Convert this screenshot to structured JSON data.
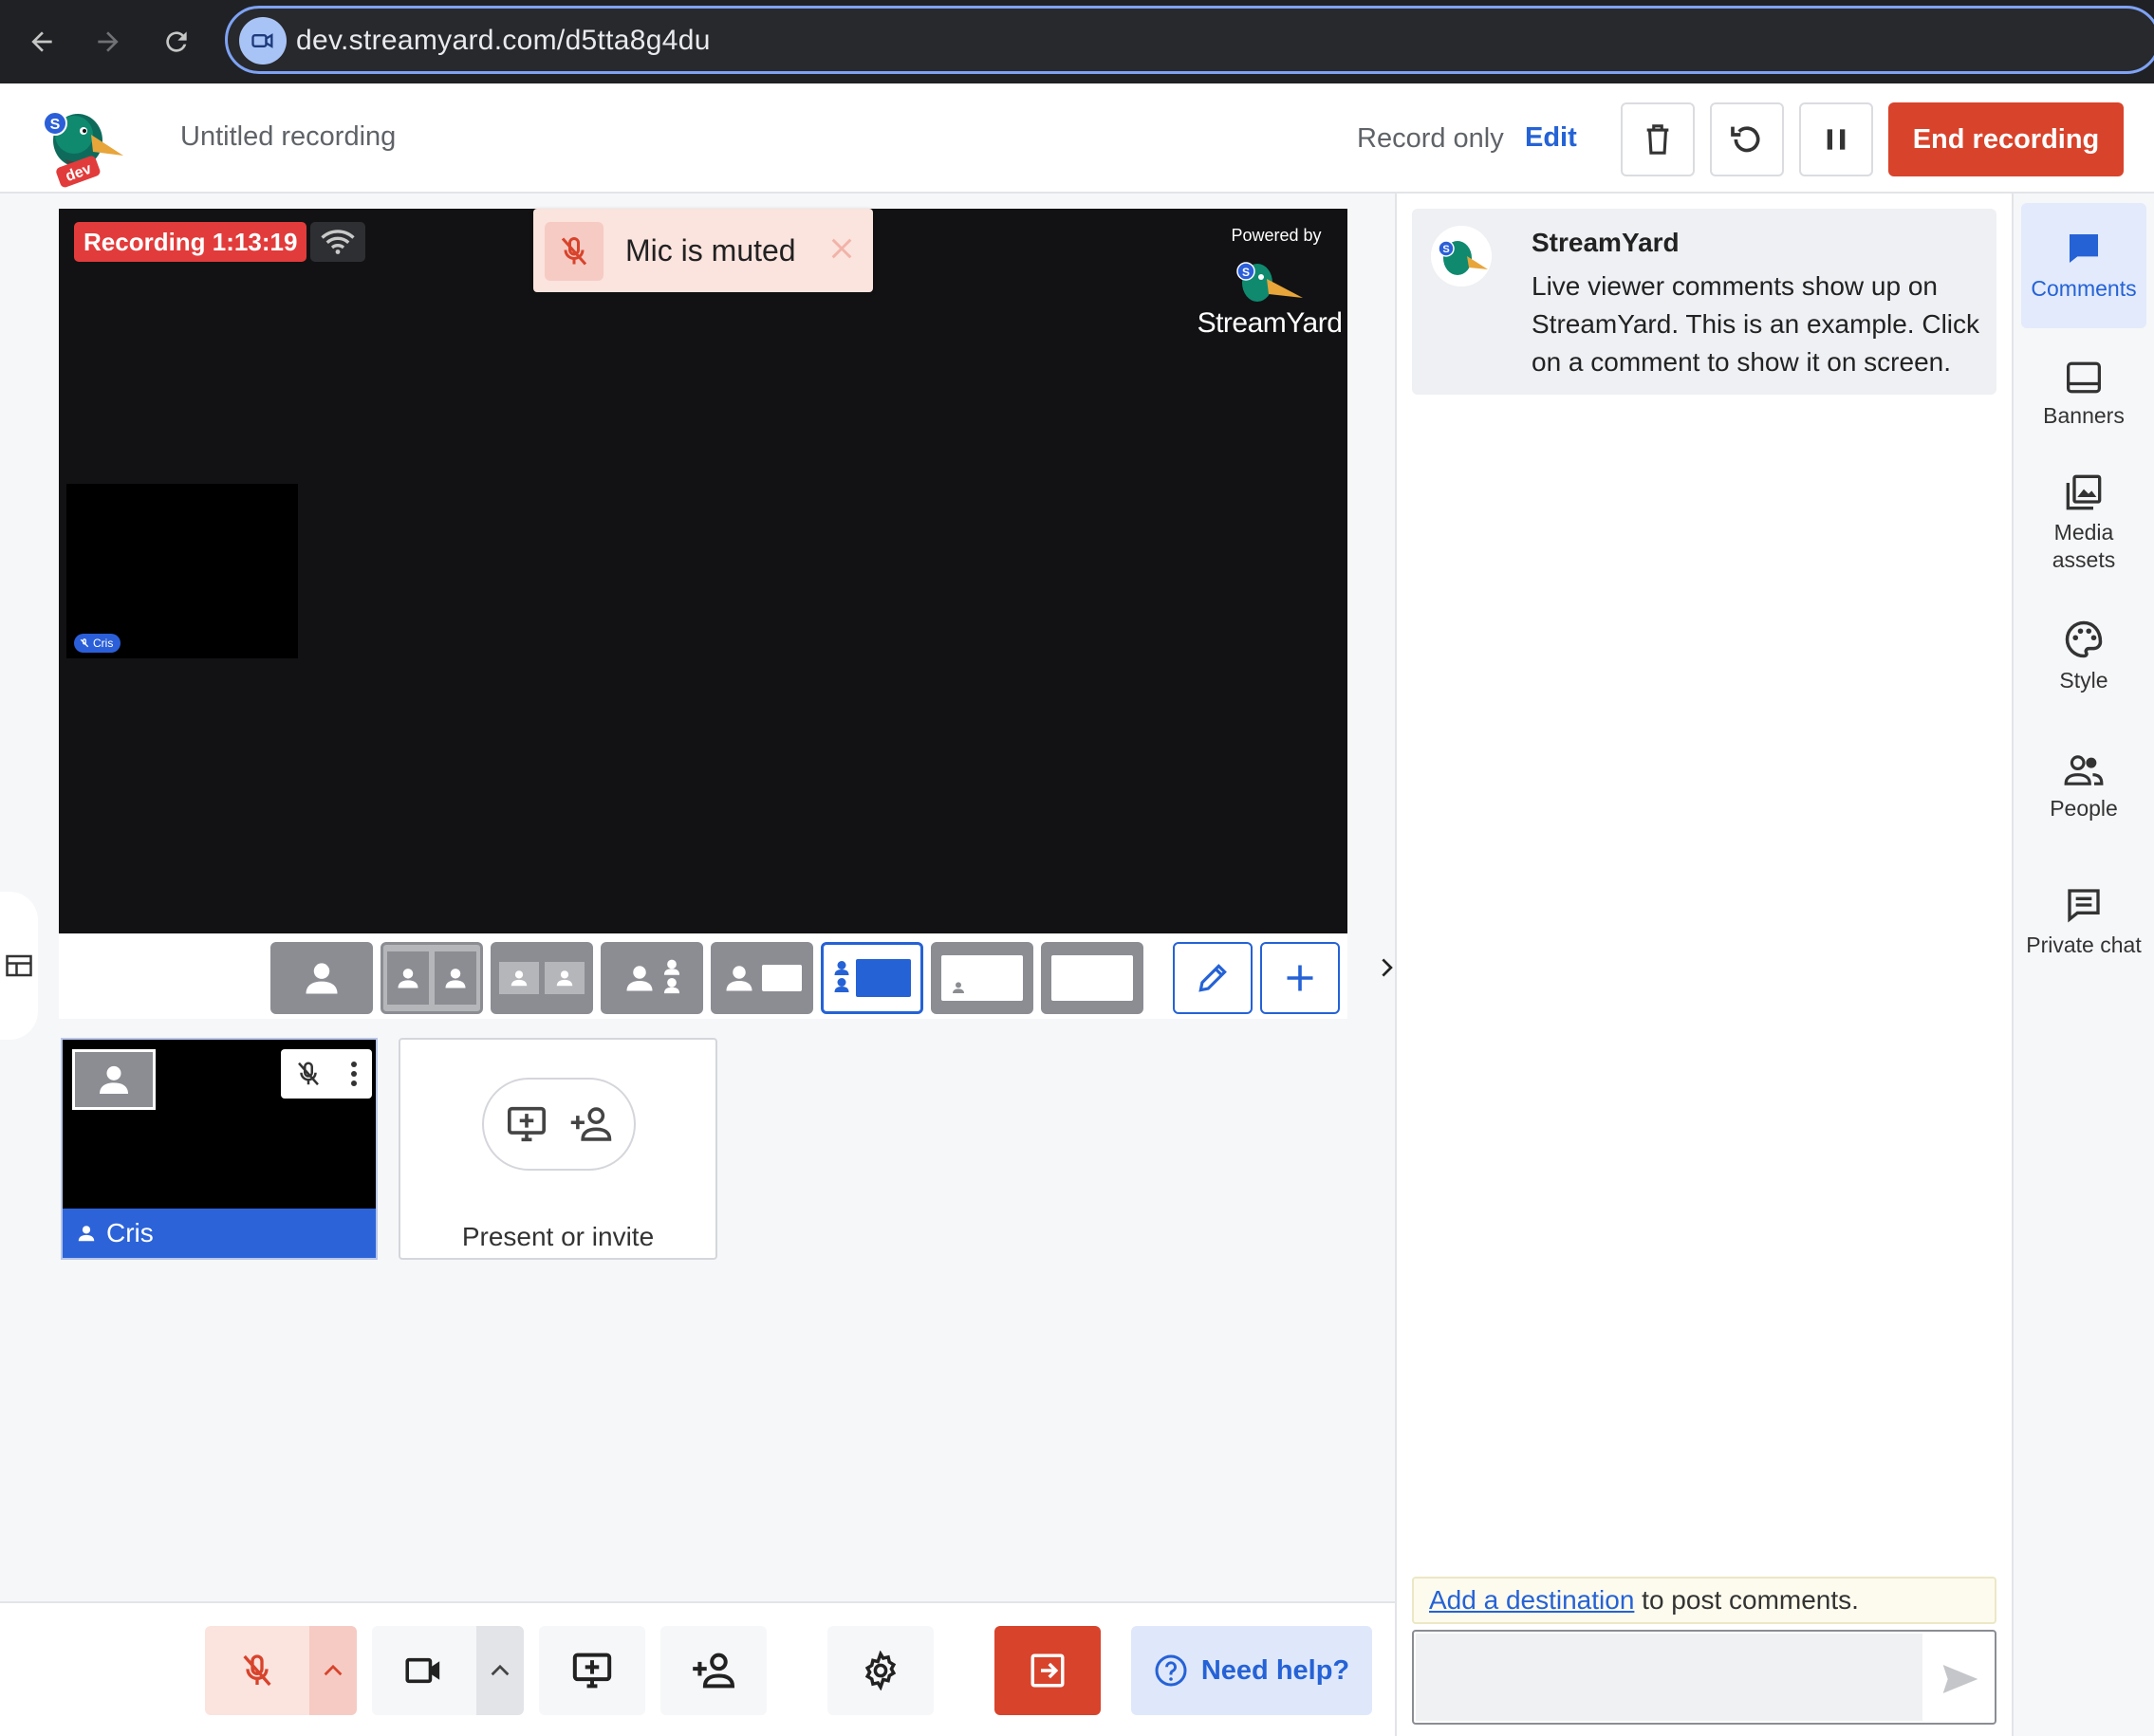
{
  "browser": {
    "url": "dev.streamyard.com/d5tta8g4du",
    "back_icon": "arrow-left-icon",
    "forward_icon": "arrow-right-icon",
    "reload_icon": "reload-icon"
  },
  "header": {
    "logo_badge": "dev",
    "title": "Untitled recording",
    "record_only": "Record only",
    "edit_label": "Edit",
    "end_recording_label": "End recording"
  },
  "stage": {
    "recording_label": "Recording 1:13:19",
    "powered_by": "Powered by",
    "brand_name": "StreamYard",
    "tile_name": "Cris"
  },
  "toast": {
    "message": "Mic is muted"
  },
  "layouts": {
    "selected_index": 5,
    "count": 8
  },
  "participants": {
    "cris_name": "Cris",
    "present_invite_label": "Present or invite"
  },
  "bottom_bar": {
    "need_help_label": "Need help?"
  },
  "comments": {
    "sample_author": "StreamYard",
    "sample_text": "Live viewer comments show up on StreamYard. This is an example. Click on a comment to show it on screen.",
    "destination_link": "Add a destination",
    "destination_rest": " to post comments.",
    "input_placeholder": ""
  },
  "rail": {
    "comments": "Comments",
    "banners": "Banners",
    "media_assets": "Media assets",
    "style": "Style",
    "people": "People",
    "private_chat": "Private chat"
  },
  "colors": {
    "accent": "#2562d6",
    "danger": "#d8432b",
    "recording": "#e23b3b"
  }
}
